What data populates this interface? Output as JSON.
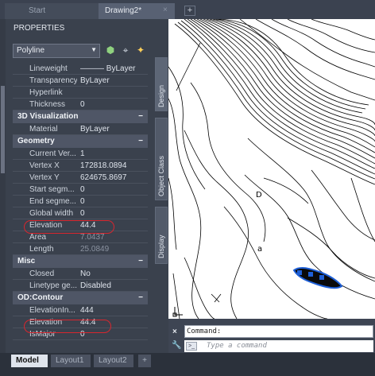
{
  "file_tabs": {
    "start": "Start",
    "drawing": "Drawing2*",
    "close": "×",
    "new": "+"
  },
  "palette": {
    "title": "PROPERTIES",
    "object_type": "Polyline",
    "rows_top": [
      {
        "label": "Lineweight",
        "value": "——— ByLayer"
      },
      {
        "label": "Transparency",
        "value": "ByLayer"
      },
      {
        "label": "Hyperlink",
        "value": ""
      },
      {
        "label": "Thickness",
        "value": "0"
      }
    ],
    "sec_3d": {
      "title": "3D Visualization",
      "collapse": "−"
    },
    "rows_3d": [
      {
        "label": "Material",
        "value": "ByLayer"
      }
    ],
    "sec_geometry": {
      "title": "Geometry",
      "collapse": "−"
    },
    "rows_geometry": [
      {
        "label": "Current Ver...",
        "value": "1"
      },
      {
        "label": "Vertex X",
        "value": "172818.0894"
      },
      {
        "label": "Vertex Y",
        "value": "624675.8697"
      },
      {
        "label": "Start segm...",
        "value": "0"
      },
      {
        "label": "End segme...",
        "value": "0"
      },
      {
        "label": "Global width",
        "value": "0"
      },
      {
        "label": "Elevation",
        "value": "44.4"
      },
      {
        "label": "Area",
        "value": "7.0437"
      },
      {
        "label": "Length",
        "value": "25.0849"
      }
    ],
    "sec_misc": {
      "title": "Misc",
      "collapse": "−"
    },
    "rows_misc": [
      {
        "label": "Closed",
        "value": "No"
      },
      {
        "label": "Linetype ge...",
        "value": "Disabled"
      }
    ],
    "sec_od": {
      "title": "OD:Contour",
      "collapse": "−"
    },
    "rows_od": [
      {
        "label": "ElevationIn...",
        "value": "444"
      },
      {
        "label": "Elevation",
        "value": "44.4"
      },
      {
        "label": "IsMajor",
        "value": "0"
      }
    ]
  },
  "side_tabs": {
    "design": "Design",
    "object_class": "Object Class",
    "display": "Display"
  },
  "command": {
    "history": "Command:",
    "placeholder": "Type a command",
    "close": "×"
  },
  "layout_tabs": {
    "model": "Model",
    "layout1": "Layout1",
    "layout2": "Layout2",
    "add": "+"
  },
  "colors": {
    "highlight": "#d8262e",
    "selected_polyline": "#1e5fd6"
  }
}
